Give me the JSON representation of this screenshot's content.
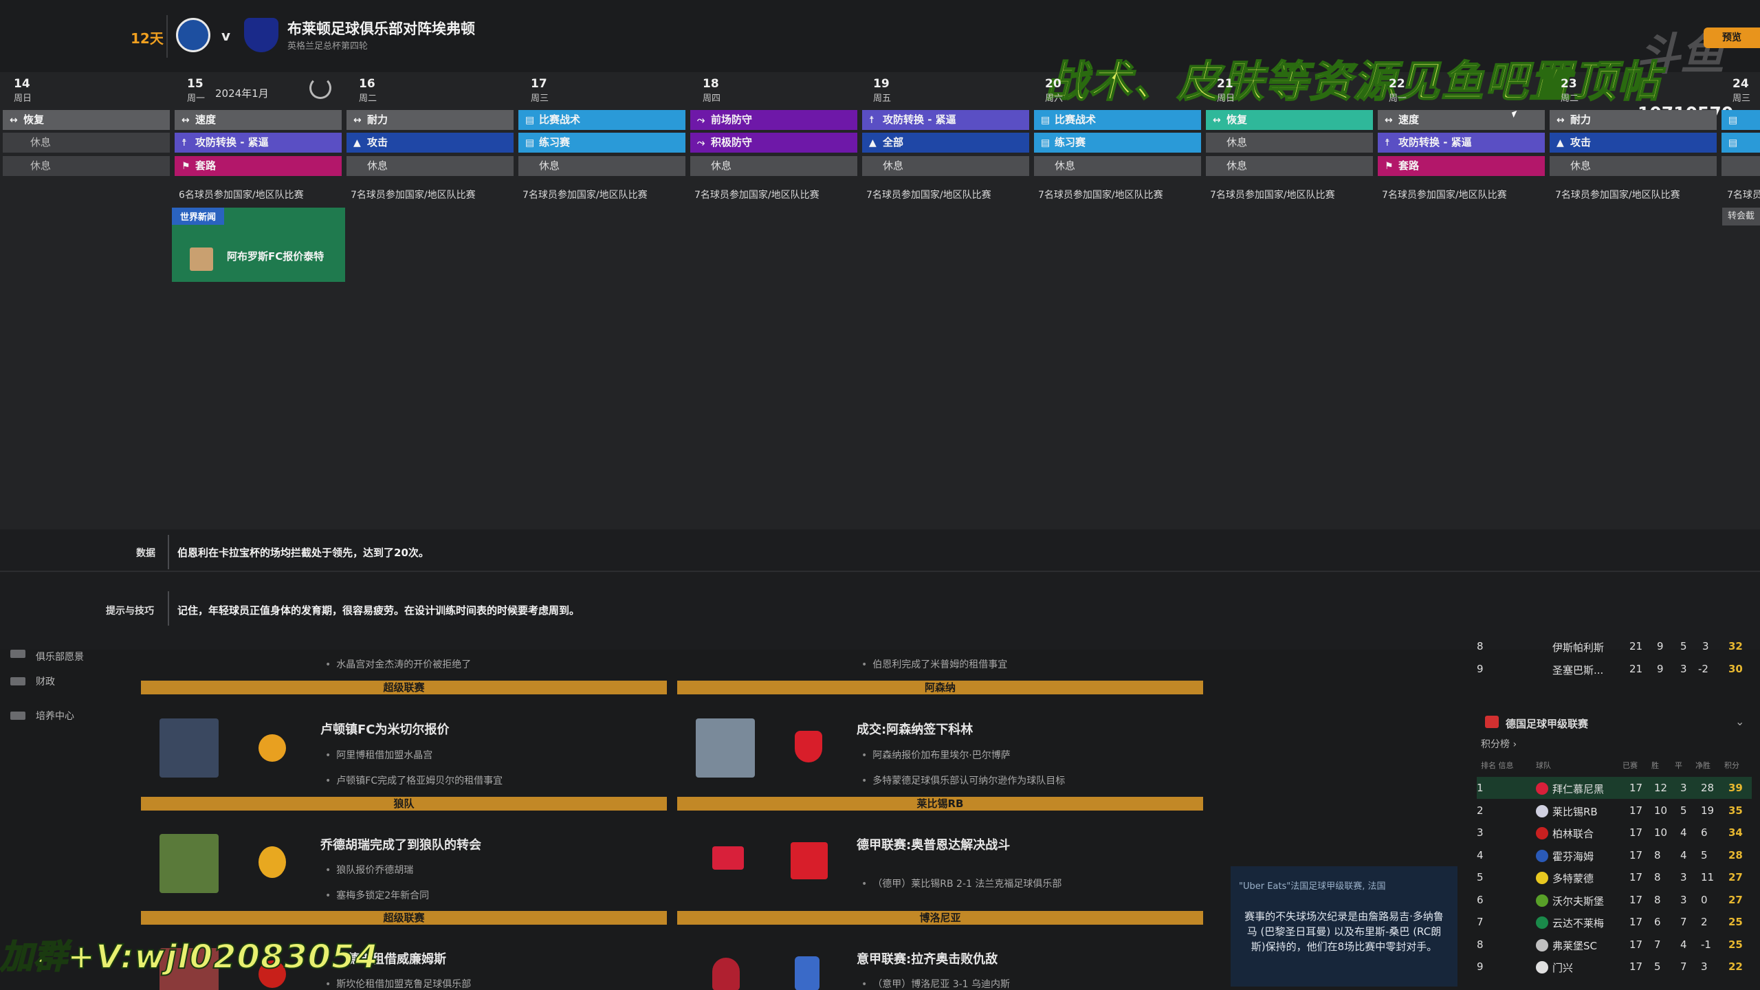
{
  "header": {
    "days_left": "12天",
    "vs": "v",
    "match_title": "布莱顿足球俱乐部对阵埃弗顿",
    "match_sub": "英格兰足总杯第四轮",
    "preview_btn": "预览",
    "overlay_banner": "战术、皮肤等资源见鱼吧置顶帖",
    "counter": "10710570",
    "logo_text": "斗鱼"
  },
  "calendar": {
    "month": "2024年1月",
    "days": [
      {
        "d": "14",
        "w": "周日"
      },
      {
        "d": "15",
        "w": "周一"
      },
      {
        "d": "16",
        "w": "周二"
      },
      {
        "d": "17",
        "w": "周三"
      },
      {
        "d": "18",
        "w": "周四"
      },
      {
        "d": "19",
        "w": "周五"
      },
      {
        "d": "20",
        "w": "周六"
      },
      {
        "d": "21",
        "w": "周日"
      },
      {
        "d": "22",
        "w": "周一"
      },
      {
        "d": "23",
        "w": "周二"
      },
      {
        "d": "24",
        "w": "周三"
      }
    ],
    "sessions": {
      "recover": "恢复",
      "speed": "速度",
      "stamina": "耐力",
      "match_tactics": "比赛战术",
      "press_defend": "前场防守",
      "attack_transition": "攻防转换 - 紧逼",
      "rest": "休息",
      "attack": "攻击",
      "practice_match": "练习赛",
      "active_defend": "积极防守",
      "all": "全部",
      "set_pieces": "套路"
    },
    "intl_6": "6名球员参加国家/地区队比赛",
    "intl_7": "7名球员参加国家/地区队比赛",
    "world_news_tag": "世界新闻",
    "world_news_text": "阿布罗斯FC报价泰特",
    "transfer_btn": "转会截"
  },
  "info": {
    "data_label": "数据",
    "data_text": "伯恩利在卡拉宝杯的场均拦截处于领先，达到了20次。",
    "tips_label": "提示与技巧",
    "tips_text": "记住，年轻球员正值身体的发育期，很容易疲劳。在设计训练时间表的时候要考虑周到。"
  },
  "sidebar": {
    "club_vision": "俱乐部愿景",
    "finance": "财政",
    "development": "培养中心"
  },
  "news": {
    "partial_1": "水晶宫对金杰涛的开价被拒绝了",
    "partial_2": "伯恩利完成了米普姆的租借事宜",
    "sec_premier_1": "超级联赛",
    "sec_arsenal": "阿森纳",
    "luton_title": "卢顿镇FC为米切尔报价",
    "luton_b1": "阿里博租借加盟水晶宫",
    "luton_b2": "卢顿镇FC完成了格亚姆贝尔的租借事宜",
    "arsenal_title": "成交:阿森纳签下科林",
    "arsenal_b1": "阿森纳报价加布里埃尔·巴尔博萨",
    "arsenal_b2": "多特蒙德足球俱乐部认可纳尔逊作为球队目标",
    "sec_wolves": "狼队",
    "sec_leipzig": "莱比锡RB",
    "wolves_title": "乔德胡瑞完成了到狼队的转会",
    "wolves_b1": "狼队报价乔德胡瑞",
    "wolves_b2": "塞梅多锁定2年新合同",
    "leipzig_title": "德甲联赛:奥普恩达解决战斗",
    "leipzig_b1": "（德甲）莱比锡RB 2-1 法兰克福足球俱乐部",
    "sec_premier_2": "超级联赛",
    "sec_bologna": "博洛尼亚",
    "bottom_left_title": "德市租借威廉姆斯",
    "bottom_left_b1": "斯坎伦租借加盟克鲁足球俱乐部",
    "bologna_title": "意甲联赛:拉齐奥击败仇敌",
    "bologna_b1": "（意甲）博洛尼亚 3-1 乌迪内斯"
  },
  "promo": {
    "title": "\"Uber Eats\"法国足球甲级联赛, 法国",
    "body": "赛事的不失球场次纪录是由詹路易吉·多纳鲁马 (巴黎圣日耳曼) 以及布里斯-桑巴 (RC朗斯)保持的，他们在8场比赛中零封对手。"
  },
  "table": {
    "league": "德国足球甲级联赛",
    "points_link": "积分榜 ›",
    "cols": {
      "rank": "排名 信息",
      "team": "球队",
      "played": "已赛",
      "win": "胜",
      "draw": "平",
      "gd": "净胜",
      "pts": "积分"
    },
    "pre_rows": [
      {
        "rank": "8",
        "team": "伊斯帕利斯",
        "p": "21",
        "w": "9",
        "d": "5",
        "gd": "3",
        "pts": "32"
      },
      {
        "rank": "9",
        "team": "圣塞巴斯...",
        "p": "21",
        "w": "9",
        "d": "3",
        "gd": "-2",
        "pts": "30"
      }
    ],
    "rows": [
      {
        "rank": "1",
        "team": "拜仁慕尼黑",
        "p": "17",
        "w": "12",
        "d": "3",
        "gd": "28",
        "pts": "39",
        "color": "#d8203a"
      },
      {
        "rank": "2",
        "team": "莱比锡RB",
        "p": "17",
        "w": "10",
        "d": "5",
        "gd": "19",
        "pts": "35",
        "color": "#d0d0e0"
      },
      {
        "rank": "3",
        "team": "柏林联合",
        "p": "17",
        "w": "10",
        "d": "4",
        "gd": "6",
        "pts": "34",
        "color": "#c82020"
      },
      {
        "rank": "4",
        "team": "霍芬海姆",
        "p": "17",
        "w": "8",
        "d": "4",
        "gd": "5",
        "pts": "28",
        "color": "#2a5ab8"
      },
      {
        "rank": "5",
        "team": "多特蒙德",
        "p": "17",
        "w": "8",
        "d": "3",
        "gd": "11",
        "pts": "27",
        "color": "#e8c820"
      },
      {
        "rank": "6",
        "team": "沃尔夫斯堡",
        "p": "17",
        "w": "8",
        "d": "3",
        "gd": "0",
        "pts": "27",
        "color": "#58a028"
      },
      {
        "rank": "7",
        "team": "云达不莱梅",
        "p": "17",
        "w": "6",
        "d": "7",
        "gd": "2",
        "pts": "25",
        "color": "#1a8a4a"
      },
      {
        "rank": "8",
        "team": "弗莱堡SC",
        "p": "17",
        "w": "7",
        "d": "4",
        "gd": "-1",
        "pts": "25",
        "color": "#c0c0c0"
      },
      {
        "rank": "9",
        "team": "门兴",
        "p": "17",
        "w": "5",
        "d": "7",
        "gd": "3",
        "pts": "22",
        "color": "#e0e0e0"
      }
    ]
  },
  "bottom_watermark": "加群+V:wjl02083054"
}
